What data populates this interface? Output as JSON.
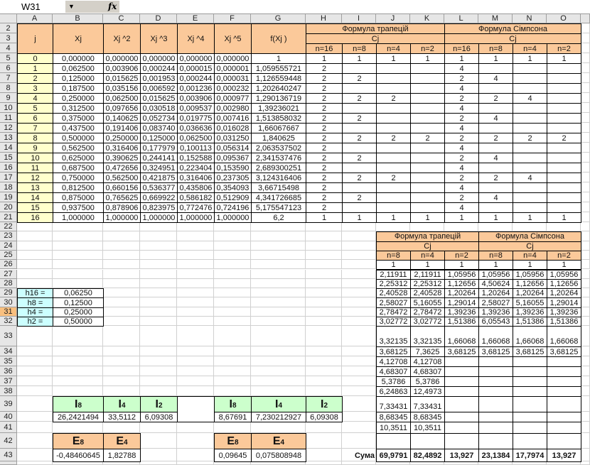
{
  "formula_bar": {
    "name_box": "W31",
    "fx_label": "fx",
    "formula": ""
  },
  "columns": [
    "A",
    "B",
    "C",
    "D",
    "E",
    "F",
    "G",
    "H",
    "I",
    "J",
    "K",
    "L",
    "M",
    "N",
    "O"
  ],
  "active_row": 31,
  "colors": {
    "header_peach": "#fbc99a",
    "index_yellow": "#ffffcc",
    "step_cyan": "#ccffff",
    "result_green": "#ccffcc",
    "active_row_header": "#f9c07f"
  },
  "top_table": {
    "headers": [
      "j",
      "Xj",
      "Xj ^2",
      "Xj ^3",
      "Xj ^4",
      "Xj ^5",
      "f(Xj )"
    ],
    "methods": [
      "Формула трапецій",
      "Формула Сімпсона"
    ],
    "cj": "Cj",
    "n_labels": [
      "n=16",
      "n=8",
      "n=4",
      "n=2"
    ],
    "rows": [
      [
        "0",
        "0,000000",
        "0,000000",
        "0,000000",
        "0,000000",
        "0,000000",
        "1",
        "1",
        "1",
        "1",
        "1",
        "1",
        "1",
        "1",
        "1"
      ],
      [
        "1",
        "0,062500",
        "0,003906",
        "0,000244",
        "0,000015",
        "0,000001",
        "1,059555721",
        "2",
        "",
        "",
        "",
        "4",
        "",
        "",
        ""
      ],
      [
        "2",
        "0,125000",
        "0,015625",
        "0,001953",
        "0,000244",
        "0,000031",
        "1,126559448",
        "2",
        "2",
        "",
        "",
        "2",
        "4",
        "",
        ""
      ],
      [
        "3",
        "0,187500",
        "0,035156",
        "0,006592",
        "0,001236",
        "0,000232",
        "1,202640247",
        "2",
        "",
        "",
        "",
        "4",
        "",
        "",
        ""
      ],
      [
        "4",
        "0,250000",
        "0,062500",
        "0,015625",
        "0,003906",
        "0,000977",
        "1,290136719",
        "2",
        "2",
        "2",
        "",
        "2",
        "2",
        "4",
        ""
      ],
      [
        "5",
        "0,312500",
        "0,097656",
        "0,030518",
        "0,009537",
        "0,002980",
        "1,39236021",
        "2",
        "",
        "",
        "",
        "4",
        "",
        "",
        ""
      ],
      [
        "6",
        "0,375000",
        "0,140625",
        "0,052734",
        "0,019775",
        "0,007416",
        "1,513858032",
        "2",
        "2",
        "",
        "",
        "2",
        "4",
        "",
        ""
      ],
      [
        "7",
        "0,437500",
        "0,191406",
        "0,083740",
        "0,036636",
        "0,016028",
        "1,66067667",
        "2",
        "",
        "",
        "",
        "4",
        "",
        "",
        ""
      ],
      [
        "8",
        "0,500000",
        "0,250000",
        "0,125000",
        "0,062500",
        "0,031250",
        "1,840625",
        "2",
        "2",
        "2",
        "2",
        "2",
        "2",
        "2",
        "2"
      ],
      [
        "9",
        "0,562500",
        "0,316406",
        "0,177979",
        "0,100113",
        "0,056314",
        "2,063537502",
        "2",
        "",
        "",
        "",
        "4",
        "",
        "",
        ""
      ],
      [
        "10",
        "0,625000",
        "0,390625",
        "0,244141",
        "0,152588",
        "0,095367",
        "2,341537476",
        "2",
        "2",
        "",
        "",
        "2",
        "4",
        "",
        ""
      ],
      [
        "11",
        "0,687500",
        "0,472656",
        "0,324951",
        "0,223404",
        "0,153590",
        "2,689300251",
        "2",
        "",
        "",
        "",
        "4",
        "",
        "",
        ""
      ],
      [
        "12",
        "0,750000",
        "0,562500",
        "0,421875",
        "0,316406",
        "0,237305",
        "3,124316406",
        "2",
        "2",
        "2",
        "",
        "2",
        "2",
        "4",
        ""
      ],
      [
        "13",
        "0,812500",
        "0,660156",
        "0,536377",
        "0,435806",
        "0,354093",
        "3,66715498",
        "2",
        "",
        "",
        "",
        "4",
        "",
        "",
        ""
      ],
      [
        "14",
        "0,875000",
        "0,765625",
        "0,669922",
        "0,586182",
        "0,512909",
        "4,341726685",
        "2",
        "2",
        "",
        "",
        "2",
        "4",
        "",
        ""
      ],
      [
        "15",
        "0,937500",
        "0,878906",
        "0,823975",
        "0,772476",
        "0,724196",
        "5,175547123",
        "2",
        "",
        "",
        "",
        "4",
        "",
        "",
        ""
      ],
      [
        "16",
        "1,000000",
        "1,000000",
        "1,000000",
        "1,000000",
        "1,000000",
        "6,2",
        "1",
        "1",
        "1",
        "1",
        "1",
        "1",
        "1",
        "1"
      ]
    ]
  },
  "steps": [
    {
      "label": "h16 =",
      "value": "0,06250"
    },
    {
      "label": "h8 =",
      "value": "0,12500"
    },
    {
      "label": "h4 =",
      "value": "0,25000"
    },
    {
      "label": "h2 =",
      "value": "0,50000"
    }
  ],
  "products_table": {
    "methods": [
      "Формула трапецій",
      "Формула Сімпсона"
    ],
    "cj": "Cj",
    "n_labels": [
      "n=8",
      "n=4",
      "n=2",
      "n=8",
      "n=4",
      "n=2"
    ],
    "rows": [
      [
        "1",
        "1",
        "1",
        "1",
        "1",
        "1"
      ],
      [
        "2,11911",
        "2,11911",
        "1,05956",
        "1,05956",
        "1,05956",
        "1,05956"
      ],
      [
        "2,25312",
        "2,25312",
        "1,12656",
        "4,50624",
        "1,12656",
        "1,12656"
      ],
      [
        "2,40528",
        "2,40528",
        "1,20264",
        "1,20264",
        "1,20264",
        "1,20264"
      ],
      [
        "2,58027",
        "5,16055",
        "1,29014",
        "2,58027",
        "5,16055",
        "1,29014"
      ],
      [
        "2,78472",
        "2,78472",
        "1,39236",
        "1,39236",
        "1,39236",
        "1,39236"
      ],
      [
        "3,02772",
        "3,02772",
        "1,51386",
        "6,05543",
        "1,51386",
        "1,51386"
      ],
      [
        "3,32135",
        "3,32135",
        "1,66068",
        "1,66068",
        "1,66068",
        "1,66068"
      ],
      [
        "3,68125",
        "7,3625",
        "3,68125",
        "3,68125",
        "3,68125",
        "3,68125"
      ],
      [
        "4,12708",
        "4,12708",
        "",
        "",
        "",
        ""
      ],
      [
        "4,68307",
        "4,68307",
        "",
        "",
        "",
        ""
      ],
      [
        "5,3786",
        "5,3786",
        "",
        "",
        "",
        ""
      ],
      [
        "6,24863",
        "12,4973",
        "",
        "",
        "",
        ""
      ],
      [
        "7,33431",
        "7,33431",
        "",
        "",
        "",
        ""
      ],
      [
        "8,68345",
        "8,68345",
        "",
        "",
        "",
        ""
      ],
      [
        "10,3511",
        "10,3511",
        "",
        "",
        "",
        ""
      ],
      [
        "",
        "",
        "",
        "",
        "",
        ""
      ]
    ],
    "sum_label": "Сума",
    "sums": [
      "69,9791",
      "82,4892",
      "13,927",
      "23,1384",
      "17,7974",
      "13,927"
    ]
  },
  "integrals_trap": {
    "labels": [
      {
        "main": "I",
        "sub": "8"
      },
      {
        "main": "I",
        "sub": "4"
      },
      {
        "main": "I",
        "sub": "2"
      }
    ],
    "values": [
      "26,2421494",
      "33,5112",
      "6,09308"
    ]
  },
  "integrals_simp": {
    "labels": [
      {
        "main": "I",
        "sub": "8"
      },
      {
        "main": "I",
        "sub": "4"
      },
      {
        "main": "I",
        "sub": "2"
      }
    ],
    "values": [
      "8,67691",
      "7,230212927",
      "6,09308"
    ]
  },
  "errors_trap": {
    "labels": [
      {
        "main": "E",
        "sub": "8"
      },
      {
        "main": "E",
        "sub": "4"
      }
    ],
    "values": [
      "-0,48460645",
      "1,82788"
    ]
  },
  "errors_simp": {
    "labels": [
      {
        "main": "E",
        "sub": "8"
      },
      {
        "main": "E",
        "sub": "4"
      }
    ],
    "values": [
      "0,09645",
      "0,075808948"
    ]
  }
}
